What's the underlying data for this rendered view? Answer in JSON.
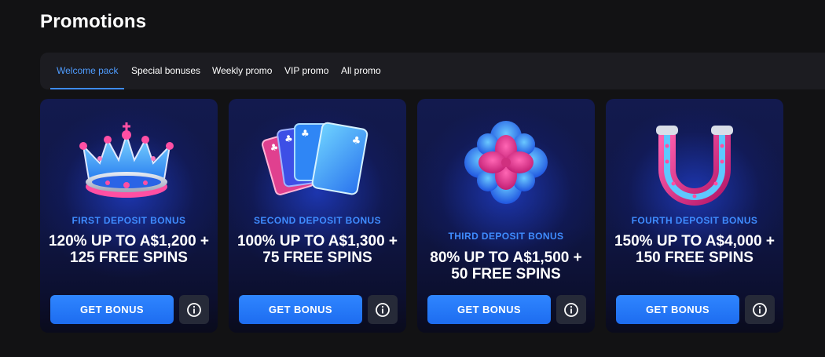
{
  "page": {
    "title": "Promotions"
  },
  "tabs": [
    {
      "label": "Welcome pack",
      "active": true
    },
    {
      "label": "Special bonuses",
      "active": false
    },
    {
      "label": "Weekly promo",
      "active": false
    },
    {
      "label": "VIP promo",
      "active": false
    },
    {
      "label": "All promo",
      "active": false
    }
  ],
  "cards": [
    {
      "art_icon": "crown-icon",
      "label": "FIRST DEPOSIT BONUS",
      "headline": "120% UP TO A$1,200 + 125 FREE SPINS",
      "button": "GET BONUS"
    },
    {
      "art_icon": "playing-cards-icon",
      "label": "SECOND DEPOSIT BONUS",
      "headline": "100% UP TO A$1,300 + 75 FREE SPINS",
      "button": "GET BONUS"
    },
    {
      "art_icon": "clover-icon",
      "label": "THIRD DEPOSIT BONUS",
      "headline": "80% UP TO A$1,500 + 50 FREE SPINS",
      "button": "GET BONUS"
    },
    {
      "art_icon": "horseshoe-icon",
      "label": "FOURTH DEPOSIT BONUS",
      "headline": "150% UP TO A$4,000 + 150 FREE SPINS",
      "button": "GET BONUS"
    }
  ],
  "colors": {
    "accent": "#3d8bff",
    "background": "#121214",
    "button": "#2f86ff"
  }
}
